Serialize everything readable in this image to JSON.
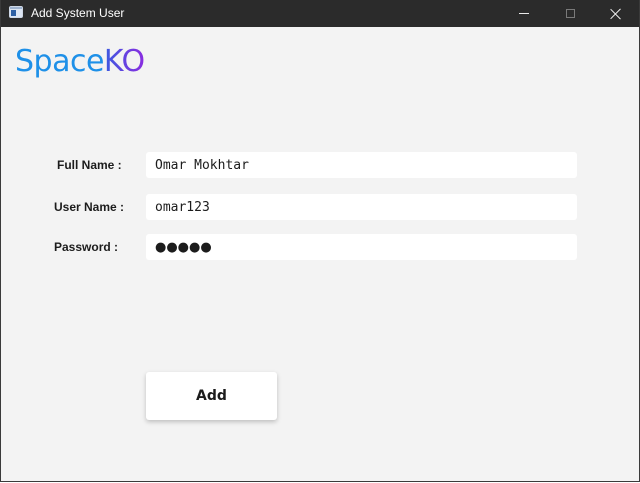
{
  "window": {
    "title": "Add System User",
    "icon": "app-window-icon",
    "controls": {
      "minimize": "minimize-icon",
      "maximize": "maximize-icon",
      "close": "close-icon"
    }
  },
  "logo": {
    "part1": "Space",
    "part2": "KO",
    "colors": {
      "part1": "#1e90e8",
      "part2_start": "#3b5be0",
      "part2_end": "#8b2be0"
    }
  },
  "form": {
    "full_name": {
      "label": "Full Name :",
      "value": "Omar Mokhtar"
    },
    "user_name": {
      "label": "User Name :",
      "value": "omar123"
    },
    "password": {
      "label": "Password :",
      "value_masked": "●●●●●"
    }
  },
  "actions": {
    "add_label": "Add"
  }
}
